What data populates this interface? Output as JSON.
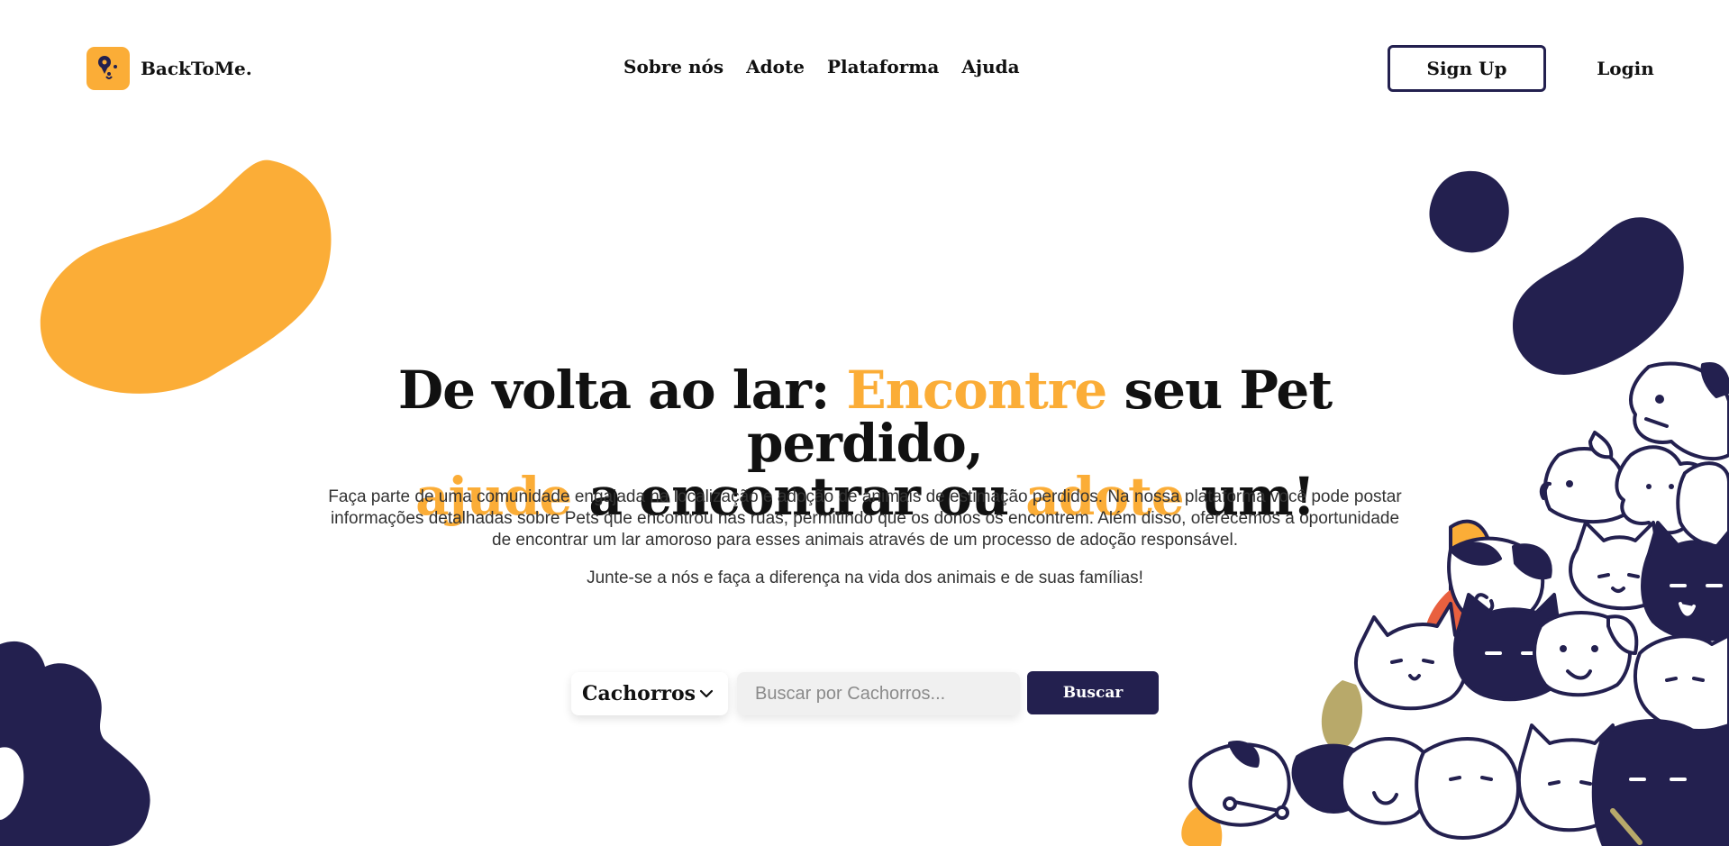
{
  "brand": {
    "name": "BackToMe."
  },
  "nav": {
    "items": [
      "Sobre nós",
      "Adote",
      "Plataforma",
      "Ajuda"
    ]
  },
  "auth": {
    "signup_label": "Sign Up",
    "login_label": "Login"
  },
  "hero": {
    "title_part1": "De volta ao lar: ",
    "title_accent1": "Encontre",
    "title_part2": " seu Pet perdido,",
    "title_accent2": "ajude",
    "title_part3": " a encontrar ou ",
    "title_accent3": "adote",
    "title_part4": " um!",
    "description": "Faça parte de uma comunidade engajada na localização e adoção de animais de estimação perdidos. Na nossa plataforma você pode postar informações detalhadas sobre Pets que encontrou nas ruas, permitindo que os donos os encontrem. Além disso, oferecemos a oportunidade de encontrar um lar amoroso para esses animais através de um processo de adoção responsável.",
    "cta_text": "Junte-se a nós e faça a diferença na vida dos animais e de suas famílias!"
  },
  "search": {
    "category_selected": "Cachorros",
    "placeholder": "Buscar por Cachorros...",
    "button_label": "Buscar"
  },
  "colors": {
    "accent": "#FBAD37",
    "navy": "#23204F",
    "coral": "#E9603F",
    "olive": "#B8A96A"
  },
  "icons": [
    "paw-location-icon",
    "chevron-down-icon"
  ]
}
